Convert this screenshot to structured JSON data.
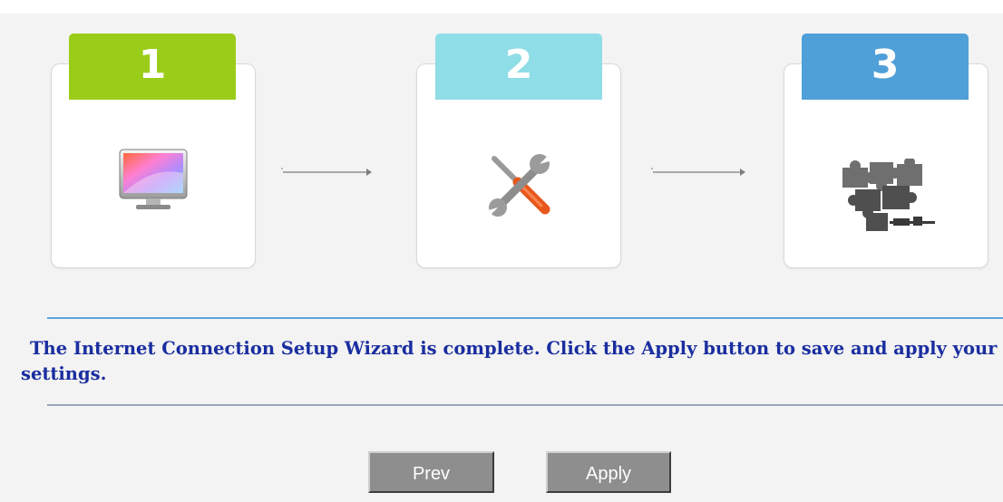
{
  "wizard": {
    "steps": [
      {
        "number": "1",
        "icon": "monitor-icon"
      },
      {
        "number": "2",
        "icon": "tools-icon"
      },
      {
        "number": "3",
        "icon": "puzzle-icon"
      }
    ],
    "message": "The Internet Connection Setup Wizard is complete. Click the Apply button to save and apply your settings."
  },
  "buttons": {
    "prev_label": "Prev",
    "apply_label": "Apply"
  },
  "colors": {
    "step1": "#9acd1a",
    "step2": "#8fdde6",
    "step3": "#4f9fd8",
    "message_text": "#1a2ea0",
    "button_bg": "#8e8e8e"
  }
}
